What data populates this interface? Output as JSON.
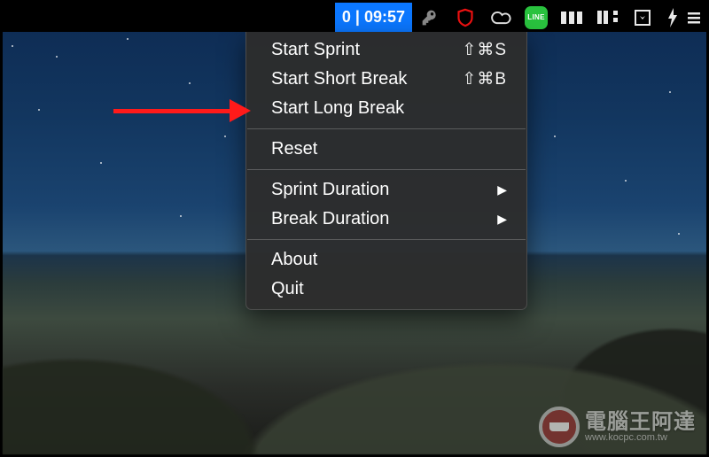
{
  "menubar": {
    "timer_text": "0 | 09:57",
    "icons": {
      "key": "key-icon",
      "shield": "shield-icon",
      "cloud": "creative-cloud-icon",
      "line": "LINE",
      "disks": "disks-icon",
      "kanban": "kanban-icon",
      "download": "download-icon",
      "bolt": "bolt-icon",
      "menu": "menu-icon"
    }
  },
  "dropdown": {
    "start_sprint": "Start Sprint",
    "start_sprint_shortcut": "⇧⌘S",
    "start_short_break": "Start Short Break",
    "start_short_break_shortcut": "⇧⌘B",
    "start_long_break": "Start Long Break",
    "reset": "Reset",
    "sprint_duration": "Sprint Duration",
    "break_duration": "Break Duration",
    "about": "About",
    "quit": "Quit",
    "submenu_arrow": "▶"
  },
  "watermark": {
    "text": "電腦王阿達",
    "url": "www.kocpc.com.tw"
  }
}
